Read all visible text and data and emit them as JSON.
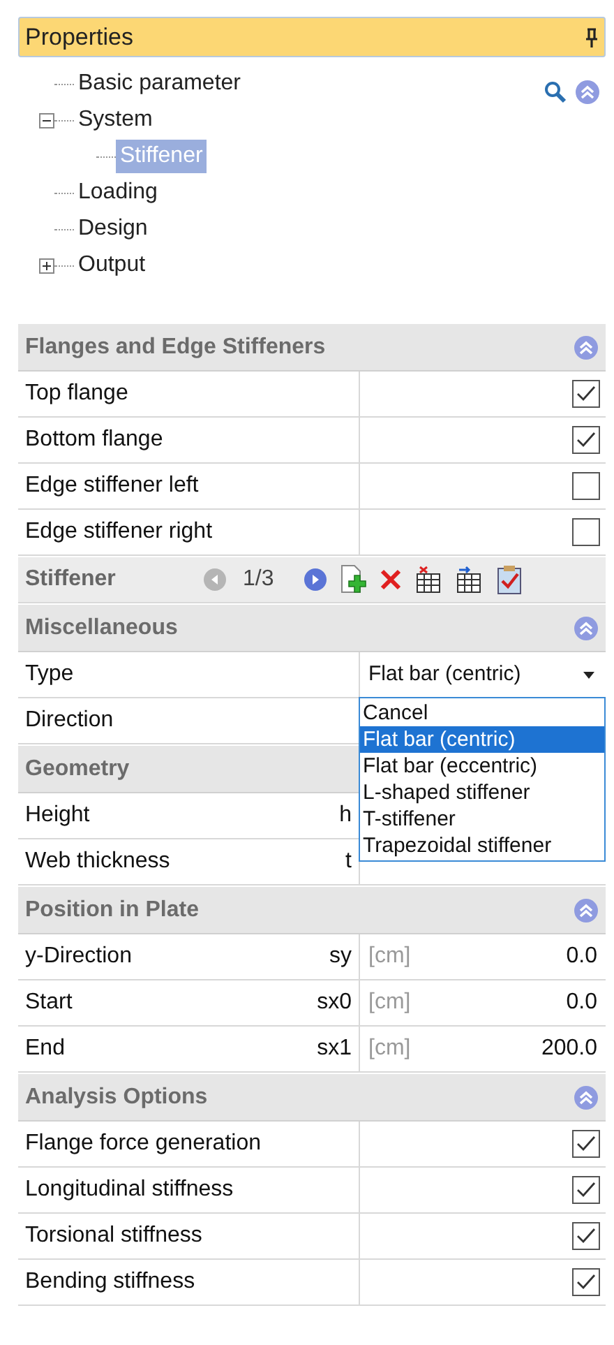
{
  "panel": {
    "title": "Properties"
  },
  "tree": [
    {
      "label": "Basic parameter",
      "selected": false
    },
    {
      "label": "System",
      "selected": false,
      "expanded": true,
      "children": [
        {
          "label": "Stiffener",
          "selected": true
        }
      ]
    },
    {
      "label": "Loading",
      "selected": false
    },
    {
      "label": "Design",
      "selected": false
    },
    {
      "label": "Output",
      "selected": false,
      "expanded": false
    }
  ],
  "groups": [
    {
      "kind": "section",
      "title": "Flanges and Edge Stiffeners",
      "rows": [
        {
          "kind": "check",
          "label": "Top flange",
          "checked": true
        },
        {
          "kind": "check",
          "label": "Bottom flange",
          "checked": true
        },
        {
          "kind": "check",
          "label": "Edge stiffener left",
          "checked": false
        },
        {
          "kind": "check",
          "label": "Edge stiffener right",
          "checked": false
        }
      ]
    },
    {
      "kind": "navigator",
      "title": "Stiffener",
      "counter": "1/3"
    },
    {
      "kind": "section",
      "title": "Miscellaneous",
      "rows": [
        {
          "kind": "select",
          "label": "Type",
          "value": "Flat bar (centric)",
          "open": true,
          "options": [
            {
              "label": "Cancel",
              "selected": false
            },
            {
              "label": "Flat bar (centric)",
              "selected": true
            },
            {
              "label": "Flat bar (eccentric)",
              "selected": false
            },
            {
              "label": "L-shaped stiffener",
              "selected": false
            },
            {
              "label": "T-stiffener",
              "selected": false
            },
            {
              "label": "Trapezoidal stiffener",
              "selected": false
            }
          ]
        },
        {
          "kind": "value",
          "label": "Direction"
        }
      ]
    },
    {
      "kind": "section",
      "title": "Geometry",
      "rows": [
        {
          "kind": "value",
          "label": "Height",
          "symbol": "h"
        },
        {
          "kind": "value",
          "label": "Web thickness",
          "symbol": "t"
        }
      ]
    },
    {
      "kind": "section",
      "title": "Position in Plate",
      "rows": [
        {
          "kind": "value",
          "label": "y-Direction",
          "symbol": "sy",
          "unit": "[cm]",
          "value": "0.0"
        },
        {
          "kind": "value",
          "label": "Start",
          "symbol": "sx0",
          "unit": "[cm]",
          "value": "0.0"
        },
        {
          "kind": "value",
          "label": "End",
          "symbol": "sx1",
          "unit": "[cm]",
          "value": "200.0"
        }
      ]
    },
    {
      "kind": "section",
      "title": "Analysis Options",
      "rows": [
        {
          "kind": "check",
          "label": "Flange force generation",
          "checked": true
        },
        {
          "kind": "check",
          "label": "Longitudinal stiffness",
          "checked": true
        },
        {
          "kind": "check",
          "label": "Torsional stiffness",
          "checked": true
        },
        {
          "kind": "check",
          "label": "Bending stiffness",
          "checked": true
        }
      ]
    }
  ]
}
